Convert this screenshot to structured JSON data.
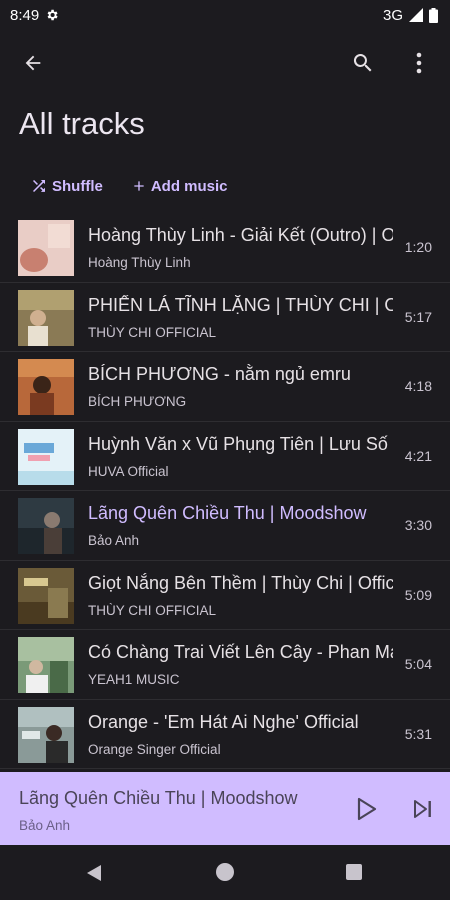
{
  "status_bar": {
    "time": "8:49",
    "network": "3G"
  },
  "header": {
    "title": "All tracks"
  },
  "actions": {
    "shuffle_label": "Shuffle",
    "add_music_label": "Add music"
  },
  "tracks": [
    {
      "title": "Hoàng Thùy Linh - Giải Kết (Outro) | Official Audio",
      "artist": "Hoàng Thùy Linh",
      "duration": "1:20",
      "thumb_color": "#e8c8c0"
    },
    {
      "title": "PHIẾN LÁ TĨNH LẶNG | THÙY CHI | Official",
      "artist": "THÙY CHI OFFICIAL",
      "duration": "5:17",
      "thumb_color": "#7a6a4a"
    },
    {
      "title": "BÍCH PHƯƠNG - nằm ngủ emru",
      "artist": "BÍCH PHƯƠNG",
      "duration": "4:18",
      "thumb_color": "#a0603a"
    },
    {
      "title": "Huỳnh Văn x Vũ Phụng Tiên | Lưu Số Em Đi",
      "artist": "HUVA Official",
      "duration": "4:21",
      "thumb_color": "#cfe6f0"
    },
    {
      "title": "Lãng Quên Chiều Thu | Moodshow",
      "artist": "Bảo Anh",
      "duration": "3:30",
      "thumb_color": "#3e4a52"
    },
    {
      "title": "Giọt Nắng Bên Thềm | Thùy Chi | Official",
      "artist": "THÙY CHI OFFICIAL",
      "duration": "5:09",
      "thumb_color": "#6b5a3a"
    },
    {
      "title": "Có Chàng Trai Viết Lên Cây - Phan Mạnh Quỳnh",
      "artist": "YEAH1 MUSIC",
      "duration": "5:04",
      "thumb_color": "#5a7a5a"
    },
    {
      "title": "Orange - 'Em Hát Ai Nghe' Official",
      "artist": "Orange Singer Official",
      "duration": "5:31",
      "thumb_color": "#7a8a88"
    }
  ],
  "active_track_index": 4,
  "mini_player": {
    "title": "Lãng Quên Chiều Thu | Moodshow",
    "artist": "Bảo Anh"
  },
  "colors": {
    "accent": "#d0bcff",
    "background": "#1c1b1f",
    "mini_player_bg": "#d0bcff"
  }
}
